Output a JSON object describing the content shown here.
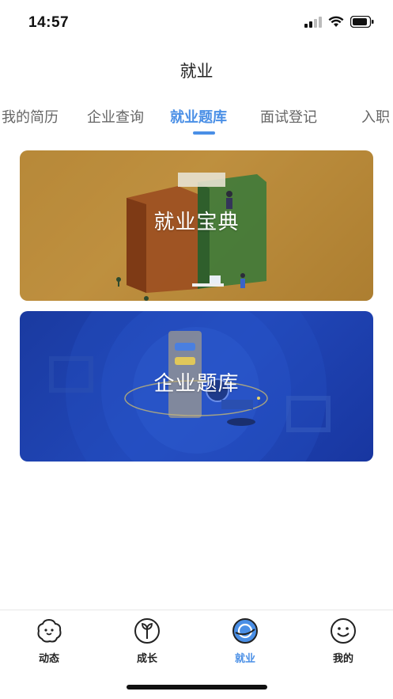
{
  "status_bar": {
    "time": "14:57"
  },
  "header": {
    "title": "就业"
  },
  "tabs": [
    {
      "label": "我的简历",
      "active": false
    },
    {
      "label": "企业查询",
      "active": false
    },
    {
      "label": "就业题库",
      "active": true
    },
    {
      "label": "面试登记",
      "active": false
    },
    {
      "label": "入职",
      "active": false
    }
  ],
  "cards": [
    {
      "title": "就业宝典",
      "color": "#b98a3a"
    },
    {
      "title": "企业题库",
      "color": "#1f44b4"
    }
  ],
  "bottom_nav": [
    {
      "label": "动态",
      "icon": "star-face-icon",
      "active": false
    },
    {
      "label": "成长",
      "icon": "sprout-icon",
      "active": false
    },
    {
      "label": "就业",
      "icon": "globe-icon",
      "active": true
    },
    {
      "label": "我的",
      "icon": "smiley-icon",
      "active": false
    }
  ],
  "colors": {
    "accent": "#4a8fe6",
    "text": "#222222",
    "tab_inactive": "#666666"
  }
}
